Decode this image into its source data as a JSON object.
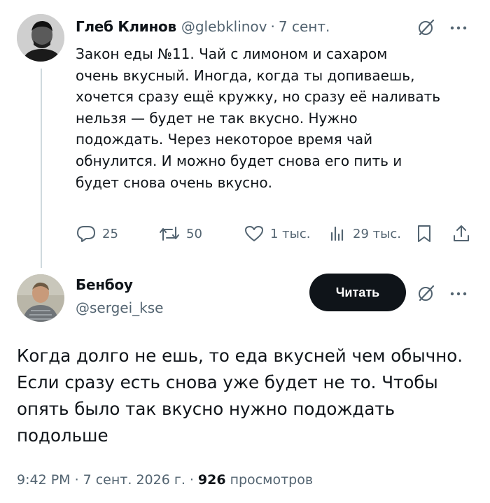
{
  "tweet1": {
    "author_name": "Глеб Клинов",
    "handle": "@glebklinov",
    "separator": "·",
    "date": "7 сент.",
    "lines": [
      "Закон еды №11. Чай с лимоном и сахаром",
      "очень вкусный. Иногда, когда ты допиваешь,",
      "хочется сразу ещё кружку, но сразу её наливать",
      "нельзя — будет не так вкусно. Нужно",
      "подождать. Через некоторое время чай",
      "обнулится. И можно будет снова его пить и",
      "будет снова очень вкусно."
    ],
    "replies": "25",
    "reposts": "50",
    "likes": "1 тыс.",
    "views": "29 тыс."
  },
  "tweet2": {
    "author_name": "Бенбоу",
    "handle": "@sergei_kse",
    "follow_label": "Читать",
    "lines": [
      "Когда долго не ешь, то еда вкусней чем обычно.",
      "Если сразу есть снова уже будет не то. Чтобы",
      "опять было так вкусно нужно подождать",
      "подольше"
    ],
    "time": "9:42 PM",
    "separator": "·",
    "date": "7 сент. 2026 г.",
    "views_count": "926",
    "views_label": "просмотров"
  },
  "colors": {
    "text": "#0f1419",
    "muted": "#536471",
    "thread_line": "#cfd9de",
    "button_bg": "#0f1419"
  },
  "icons": {
    "grok": "grok-icon",
    "more": "more-icon",
    "reply": "reply-icon",
    "repost": "repost-icon",
    "like": "heart-icon",
    "views": "views-icon",
    "bookmark": "bookmark-icon",
    "share": "share-icon"
  }
}
